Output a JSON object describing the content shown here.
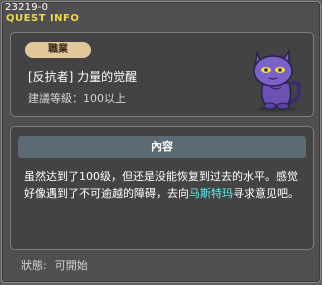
{
  "window": {
    "quest_id": "23219-0",
    "title": "QUEST INFO"
  },
  "quest": {
    "job_tag": "職業",
    "name": "[反抗者] 力量的觉醒",
    "level_requirement": "建議等級：100以上",
    "npc_icon": "purple-cat-icon"
  },
  "content": {
    "header": "內容",
    "text_before_link": "虽然达到了100级，但还是没能恢复到过去的水平。感觉好像遇到了不可逾越的障碍，去向",
    "npc_link": "马斯特玛",
    "text_after_link": "寻求意见吧。"
  },
  "status": {
    "label": "狀態:",
    "value": "可開始"
  },
  "colors": {
    "title": "#f0d84a",
    "npc_link": "#5ff0f5",
    "job_badge": "#e1c79a",
    "content_header_bg": "#5c6a73"
  }
}
